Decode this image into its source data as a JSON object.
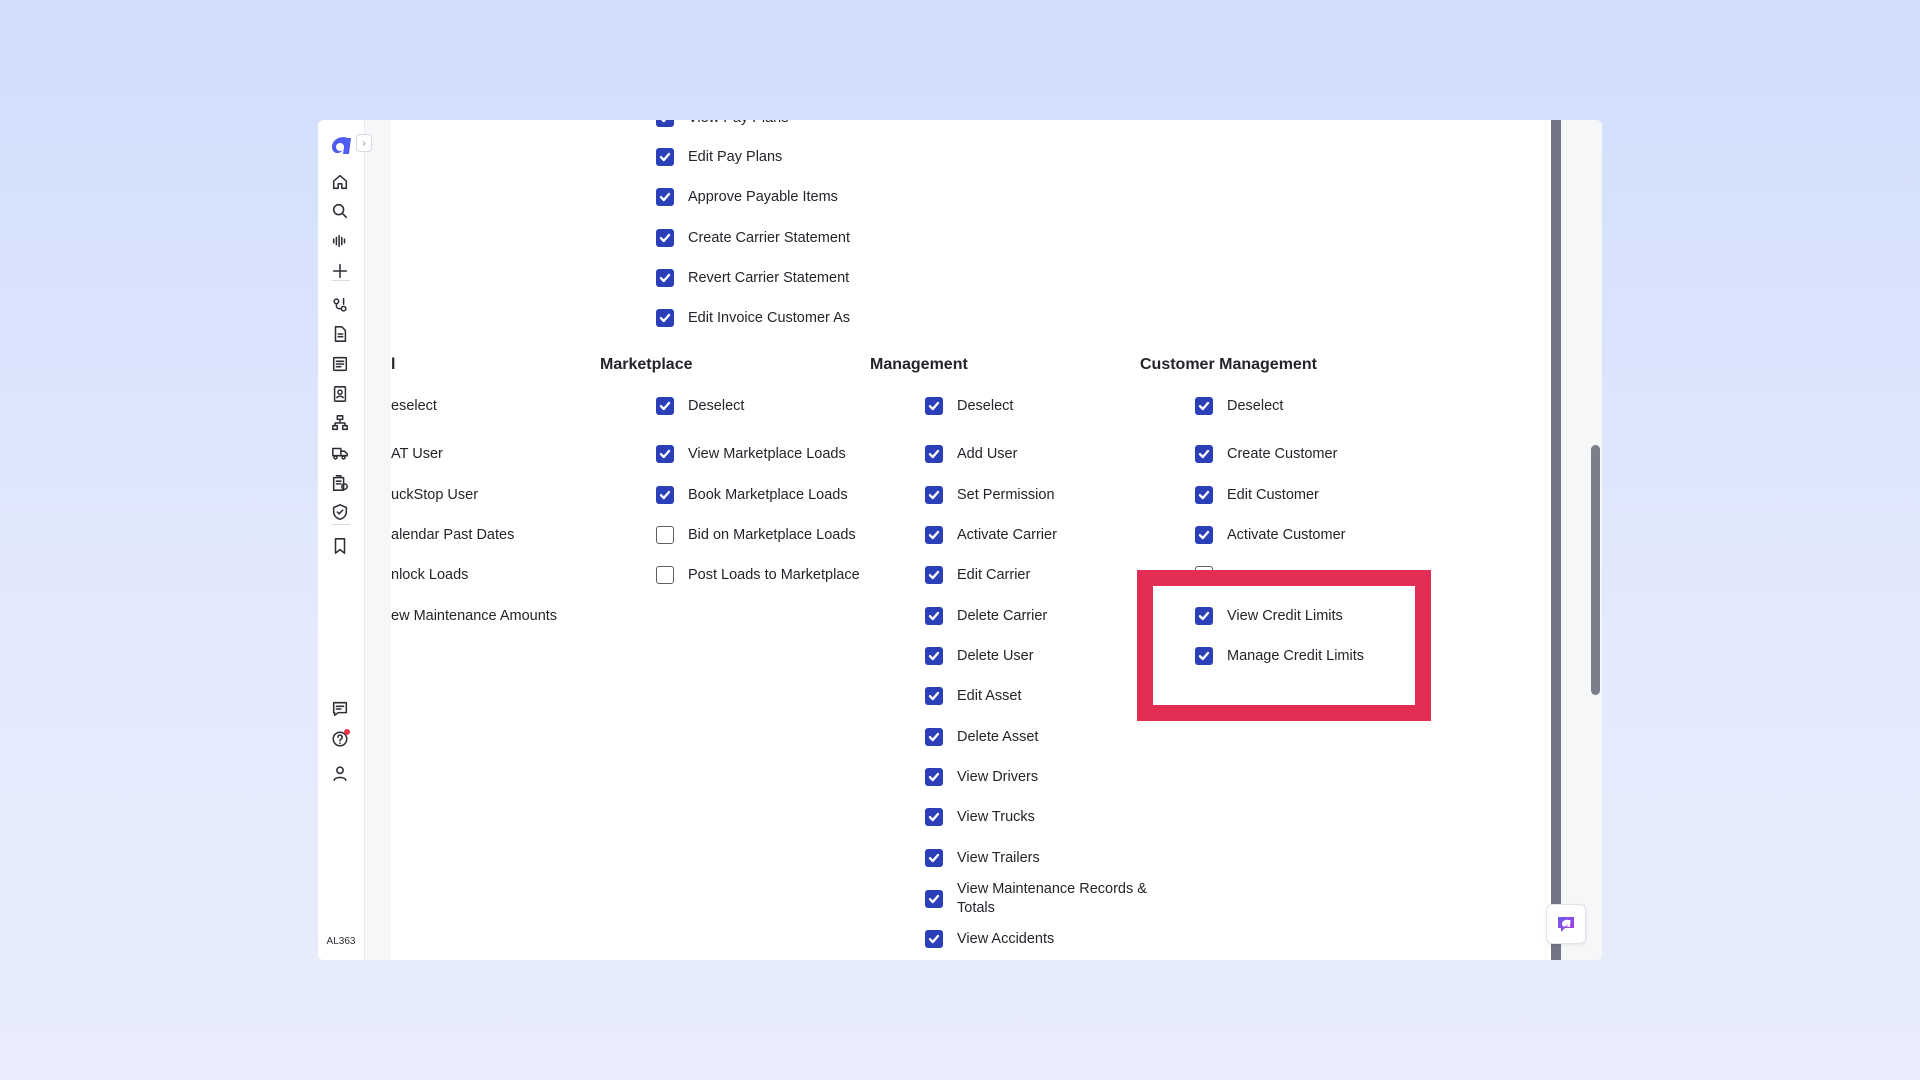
{
  "sidebar": {
    "nav_icons": [
      "home-icon",
      "search-icon",
      "audio-wave-icon",
      "plus-icon",
      "route-icon",
      "document-icon",
      "list-document-icon",
      "contacts-icon",
      "hierarchy-icon",
      "truck-icon",
      "building-icon",
      "shield-check-icon",
      "bookmark-icon"
    ],
    "footer_icons": [
      "chat-icon",
      "help-icon",
      "user-icon"
    ],
    "user_code": "AL363"
  },
  "colors": {
    "accent": "#2a3fb8",
    "highlight": "#e32d55",
    "brand": "#4f5ef0"
  },
  "top_column": {
    "items": [
      {
        "label": "View Pay Plans",
        "checked": true
      },
      {
        "label": "Edit Pay Plans",
        "checked": true
      },
      {
        "label": "Approve Payable Items",
        "checked": true
      },
      {
        "label": "Create Carrier Statement",
        "checked": true
      },
      {
        "label": "Revert Carrier Statement",
        "checked": true
      },
      {
        "label": "Edit Invoice Customer As",
        "checked": true
      }
    ]
  },
  "sections": {
    "clipped": {
      "title": "l",
      "deselect_label": "eselect",
      "items": [
        "AT User",
        "uckStop User",
        "alendar Past Dates",
        "nlock Loads",
        "ew Maintenance Amounts"
      ]
    },
    "marketplace": {
      "title": "Marketplace",
      "deselect_label": "Deselect",
      "items": [
        {
          "label": "View Marketplace Loads",
          "checked": true
        },
        {
          "label": "Book Marketplace Loads",
          "checked": true
        },
        {
          "label": "Bid on Marketplace Loads",
          "checked": false
        },
        {
          "label": "Post Loads to Marketplace",
          "checked": false
        }
      ]
    },
    "management": {
      "title": "Management",
      "deselect_label": "Deselect",
      "items": [
        {
          "label": "Add User",
          "checked": true
        },
        {
          "label": "Set Permission",
          "checked": true
        },
        {
          "label": "Activate Carrier",
          "checked": true
        },
        {
          "label": "Edit Carrier",
          "checked": true
        },
        {
          "label": "Delete Carrier",
          "checked": true
        },
        {
          "label": "Delete User",
          "checked": true
        },
        {
          "label": "Edit Asset",
          "checked": true
        },
        {
          "label": "Delete Asset",
          "checked": true
        },
        {
          "label": "View Drivers",
          "checked": true
        },
        {
          "label": "View Trucks",
          "checked": true
        },
        {
          "label": "View Trailers",
          "checked": true
        },
        {
          "label": "View Maintenance Records & Totals",
          "checked": true
        },
        {
          "label": "View Accidents",
          "checked": true
        }
      ]
    },
    "customer_management": {
      "title": "Customer Management",
      "deselect_label": "Deselect",
      "items": [
        {
          "label": "Create Customer",
          "checked": true
        },
        {
          "label": "Edit Customer",
          "checked": true
        },
        {
          "label": "Activate Customer",
          "checked": true
        },
        {
          "label": "View Credit Limits",
          "checked": true
        },
        {
          "label": "Manage Credit Limits",
          "checked": true
        }
      ]
    }
  }
}
